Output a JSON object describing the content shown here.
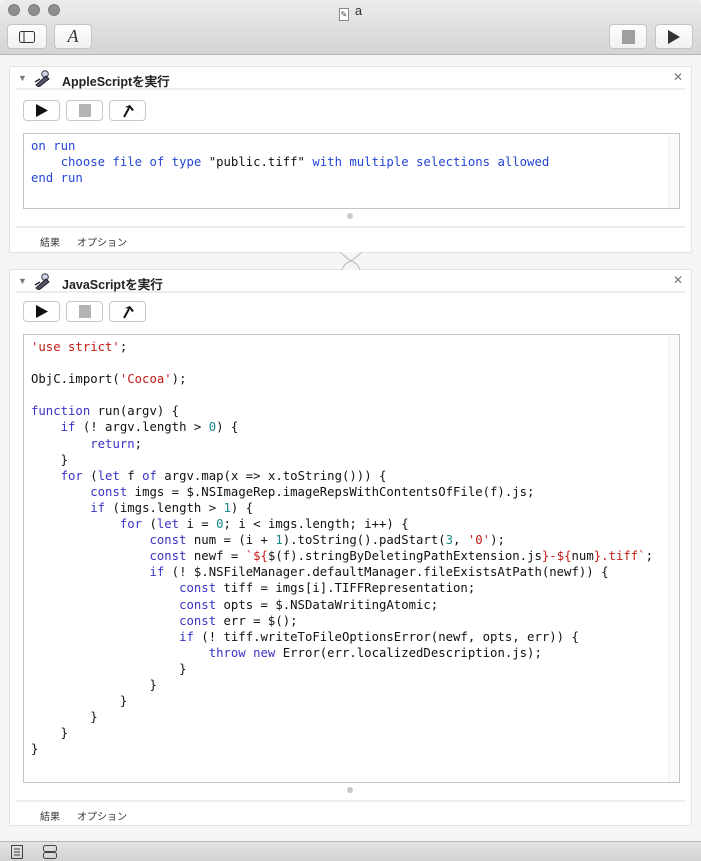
{
  "window": {
    "title": "a",
    "toolbar": {
      "sidebar_icon": "sidebar-icon",
      "font_icon": "A",
      "stop_icon": "stop-icon",
      "run_icon": "play-icon"
    }
  },
  "actions": [
    {
      "title": "AppleScriptを実行",
      "tabs": [
        "結果",
        "オプション"
      ],
      "code": [
        [
          [
            "on run",
            "as"
          ]
        ],
        [
          [
            "    ",
            ""
          ],
          [
            "choose file of type",
            "as"
          ],
          [
            " \"public.tiff\" ",
            ""
          ],
          [
            "with multiple selections allowed",
            "as"
          ]
        ],
        [
          [
            "end run",
            "as"
          ]
        ]
      ]
    },
    {
      "title": "JavaScriptを実行",
      "tabs": [
        "結果",
        "オプション"
      ],
      "code": [
        [
          [
            "'use strict'",
            "s"
          ],
          [
            ";",
            ""
          ]
        ],
        [],
        [
          [
            "ObjC.import(",
            ""
          ],
          [
            "'Cocoa'",
            "s"
          ],
          [
            ");",
            ""
          ]
        ],
        [],
        [
          [
            "function",
            "k"
          ],
          [
            " run(argv) {",
            ""
          ]
        ],
        [
          [
            "    ",
            ""
          ],
          [
            "if",
            "k"
          ],
          [
            " (! argv.length > ",
            ""
          ],
          [
            "0",
            "n"
          ],
          [
            ") {",
            ""
          ]
        ],
        [
          [
            "        ",
            ""
          ],
          [
            "return",
            "k"
          ],
          [
            ";",
            ""
          ]
        ],
        [
          [
            "    }",
            ""
          ]
        ],
        [
          [
            "    ",
            ""
          ],
          [
            "for",
            "k"
          ],
          [
            " (",
            ""
          ],
          [
            "let",
            "k"
          ],
          [
            " f ",
            ""
          ],
          [
            "of",
            "k"
          ],
          [
            " argv.map(x => x.toString())) {",
            ""
          ]
        ],
        [
          [
            "        ",
            ""
          ],
          [
            "const",
            "k"
          ],
          [
            " imgs = $.NSImageRep.imageRepsWithContentsOfFile(f).js;",
            ""
          ]
        ],
        [
          [
            "        ",
            ""
          ],
          [
            "if",
            "k"
          ],
          [
            " (imgs.length > ",
            ""
          ],
          [
            "1",
            "n"
          ],
          [
            ") {",
            ""
          ]
        ],
        [
          [
            "            ",
            ""
          ],
          [
            "for",
            "k"
          ],
          [
            " (",
            ""
          ],
          [
            "let",
            "k"
          ],
          [
            " i = ",
            ""
          ],
          [
            "0",
            "n"
          ],
          [
            "; i < imgs.length; i++) {",
            ""
          ]
        ],
        [
          [
            "                ",
            ""
          ],
          [
            "const",
            "k"
          ],
          [
            " num = (i + ",
            ""
          ],
          [
            "1",
            "n"
          ],
          [
            ").toString().padStart(",
            ""
          ],
          [
            "3",
            "n"
          ],
          [
            ", ",
            ""
          ],
          [
            "'0'",
            "s"
          ],
          [
            ");",
            ""
          ]
        ],
        [
          [
            "                ",
            ""
          ],
          [
            "const",
            "k"
          ],
          [
            " newf = ",
            ""
          ],
          [
            "`${",
            "s"
          ],
          [
            "$(f).stringByDeletingPathExtension.js",
            ""
          ],
          [
            "}-${",
            "s"
          ],
          [
            "num",
            ""
          ],
          [
            "}.tiff`",
            "s"
          ],
          [
            ";",
            ""
          ]
        ],
        [
          [
            "                ",
            ""
          ],
          [
            "if",
            "k"
          ],
          [
            " (! $.NSFileManager.defaultManager.fileExistsAtPath(newf)) {",
            ""
          ]
        ],
        [
          [
            "                    ",
            ""
          ],
          [
            "const",
            "k"
          ],
          [
            " tiff = imgs[i].TIFFRepresentation;",
            ""
          ]
        ],
        [
          [
            "                    ",
            ""
          ],
          [
            "const",
            "k"
          ],
          [
            " opts = $.NSDataWritingAtomic;",
            ""
          ]
        ],
        [
          [
            "                    ",
            ""
          ],
          [
            "const",
            "k"
          ],
          [
            " err = $();",
            ""
          ]
        ],
        [
          [
            "                    ",
            ""
          ],
          [
            "if",
            "k"
          ],
          [
            " (! tiff.writeToFileOptionsError(newf, opts, err)) {",
            ""
          ]
        ],
        [
          [
            "                        ",
            ""
          ],
          [
            "throw",
            "k"
          ],
          [
            " ",
            ""
          ],
          [
            "new",
            "k"
          ],
          [
            " Error(err.localizedDescription.js);",
            ""
          ]
        ],
        [
          [
            "                    }",
            ""
          ]
        ],
        [
          [
            "                }",
            ""
          ]
        ],
        [
          [
            "            }",
            ""
          ]
        ],
        [
          [
            "        }",
            ""
          ]
        ],
        [
          [
            "    }",
            ""
          ]
        ],
        [
          [
            "}",
            ""
          ]
        ]
      ]
    }
  ]
}
